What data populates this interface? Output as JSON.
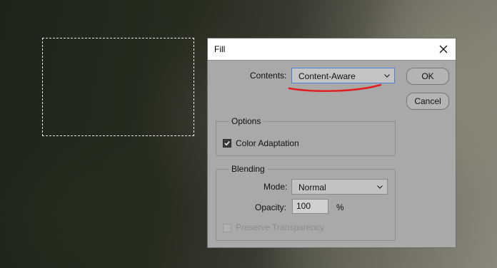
{
  "dialog": {
    "title": "Fill",
    "contents_label": "Contents:",
    "contents_value": "Content-Aware",
    "ok_label": "OK",
    "cancel_label": "Cancel",
    "options": {
      "title": "Options",
      "color_adaptation_label": "Color Adaptation",
      "color_adaptation_checked": true
    },
    "blending": {
      "title": "Blending",
      "mode_label": "Mode:",
      "mode_value": "Normal",
      "opacity_label": "Opacity:",
      "opacity_value": "100",
      "opacity_unit": "%",
      "preserve_transparency_label": "Preserve Transparency",
      "preserve_transparency_enabled": false
    }
  },
  "icons": {
    "close": "close-icon",
    "dropdown": "chevron-down-icon",
    "check": "check-icon"
  },
  "colors": {
    "annotation": "#e02020",
    "dialog_bg": "#a9a9a9",
    "focus_border": "#4a7fd2"
  }
}
